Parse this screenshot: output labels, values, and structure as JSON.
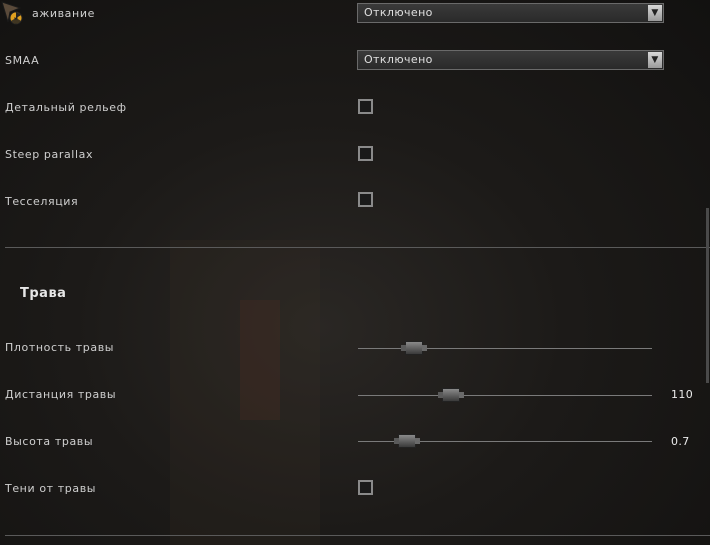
{
  "rows": {
    "antialiasing": {
      "label": "аживание",
      "value": "Отключено"
    },
    "smaa": {
      "label": "SMAA",
      "value": "Отключено"
    },
    "detail_relief": {
      "label": "Детальный рельеф"
    },
    "steep_parallax": {
      "label": "Steep parallax"
    },
    "tessellation": {
      "label": "Тесселяция"
    }
  },
  "grass": {
    "title": "Трава",
    "density": {
      "label": "Плотность травы",
      "value_fraction": 0.19
    },
    "distance": {
      "label": "Дистанция травы",
      "value": "110",
      "value_fraction": 0.31
    },
    "height": {
      "label": "Высота травы",
      "value": "0.7",
      "value_fraction": 0.16
    },
    "shadows": {
      "label": "Тени от травы"
    }
  },
  "icons": {
    "corner": "radiation-cursor-icon"
  }
}
